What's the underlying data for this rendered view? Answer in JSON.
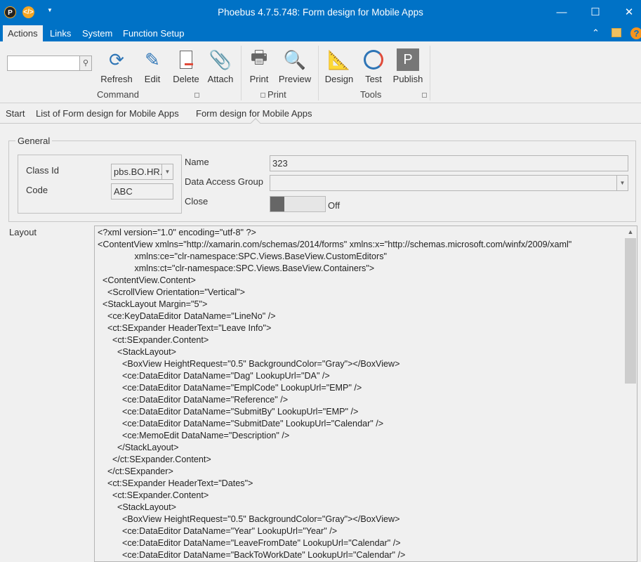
{
  "window": {
    "title": "Phoebus 4.7.5.748: Form design for Mobile Apps",
    "minimize": "—",
    "maximize": "☐",
    "close": "✕"
  },
  "menu": [
    "Actions",
    "Links",
    "System",
    "Function Setup"
  ],
  "ribbon": {
    "search": {
      "value": "",
      "placeholder": ""
    },
    "buttons": [
      {
        "label": "Refresh",
        "icon": "refresh-icon"
      },
      {
        "label": "Edit",
        "icon": "edit-icon"
      },
      {
        "label": "Delete",
        "icon": "delete-icon"
      },
      {
        "label": "Attach",
        "icon": "paperclip-icon"
      },
      {
        "label": "Print",
        "icon": "printer-icon"
      },
      {
        "label": "Preview",
        "icon": "preview-icon"
      },
      {
        "label": "Design",
        "icon": "design-icon"
      },
      {
        "label": "Test",
        "icon": "gauge-icon"
      },
      {
        "label": "Publish",
        "icon": "publish-icon",
        "glyph": "P"
      }
    ],
    "groups": [
      "Command",
      "Print",
      "Tools"
    ]
  },
  "breadcrumb": [
    "Start",
    "List of Form design for Mobile Apps",
    "Form design for Mobile Apps"
  ],
  "form": {
    "group_title": "General",
    "class_id_label": "Class Id",
    "class_id_value": "pbs.BO.HR.",
    "code_label": "Code",
    "code_value": "ABC",
    "name_label": "Name",
    "name_value": "323",
    "dag_label": "Data Access Group",
    "dag_value": "",
    "close_label": "Close",
    "close_state": "Off",
    "close_on": false,
    "layout_label": "Layout"
  },
  "layout_lines": [
    "<?xml version=\"1.0\" encoding=\"utf-8\" ?>",
    "<ContentView xmlns=\"http://xamarin.com/schemas/2014/forms\" xmlns:x=\"http://schemas.microsoft.com/winfx/2009/xaml\"",
    "               xmlns:ce=\"clr-namespace:SPC.Views.BaseView.CustomEditors\"",
    "               xmlns:ct=\"clr-namespace:SPC.Views.BaseView.Containers\">",
    "  <ContentView.Content>",
    "    <ScrollView Orientation=\"Vertical\">",
    "  <StackLayout Margin=\"5\">",
    "    <ce:KeyDataEditor DataName=\"LineNo\" />",
    "    <ct:SExpander HeaderText=\"Leave Info\">",
    "      <ct:SExpander.Content>",
    "        <StackLayout>",
    "          <BoxView HeightRequest=\"0.5\" BackgroundColor=\"Gray\"></BoxView>",
    "          <ce:DataEditor DataName=\"Dag\" LookupUrl=\"DA\" />",
    "          <ce:DataEditor DataName=\"EmplCode\" LookupUrl=\"EMP\" />",
    "          <ce:DataEditor DataName=\"Reference\" />",
    "          <ce:DataEditor DataName=\"SubmitBy\" LookupUrl=\"EMP\" />",
    "          <ce:DataEditor DataName=\"SubmitDate\" LookupUrl=\"Calendar\" />",
    "          <ce:MemoEdit DataName=\"Description\" />",
    "        </StackLayout>",
    "      </ct:SExpander.Content>",
    "    </ct:SExpander>",
    "    <ct:SExpander HeaderText=\"Dates\">",
    "      <ct:SExpander.Content>",
    "        <StackLayout>",
    "          <BoxView HeightRequest=\"0.5\" BackgroundColor=\"Gray\"></BoxView>",
    "          <ce:DataEditor DataName=\"Year\" LookupUrl=\"Year\" />",
    "          <ce:DataEditor DataName=\"LeaveFromDate\" LookupUrl=\"Calendar\" />",
    "          <ce:DataEditor DataName=\"BackToWorkDate\" LookupUrl=\"Calendar\" />"
  ],
  "colors": {
    "accent": "#0072c6",
    "icon_blue": "#2e75b6",
    "delete_red": "#e04b3a"
  }
}
